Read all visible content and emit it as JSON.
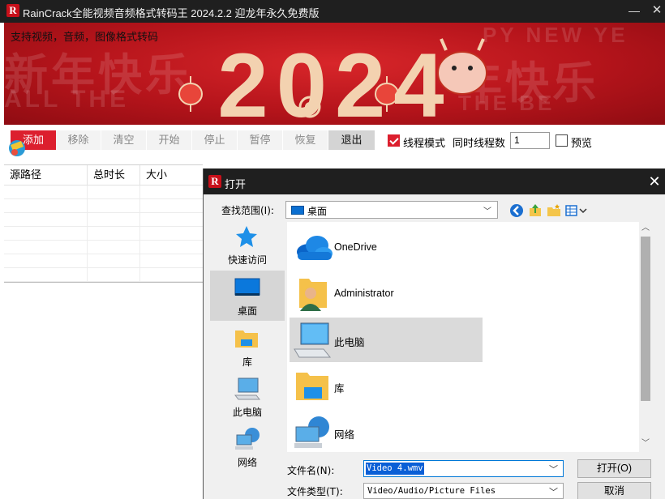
{
  "window": {
    "logo_letter": "R",
    "title": "RainCrack全能视频音频格式转码王 2024.2.2 迎龙年永久免费版",
    "minimize_glyph": "—",
    "close_glyph": "✕"
  },
  "banner": {
    "subtitle": "支持视频，音频，图像格式转码",
    "year": "2024",
    "bg_words": [
      "新年快乐",
      "ALL THE",
      "年快乐",
      "THE BE",
      "PY NEW YE"
    ],
    "colors": {
      "red": "#b5141b",
      "gold": "#f3d2b0"
    }
  },
  "toolbar": {
    "add": "添加",
    "remove": "移除",
    "clear": "清空",
    "start": "开始",
    "stop": "停止",
    "pause": "暂停",
    "resume": "恢复",
    "quit": "退出",
    "thread_mode_label": "线程模式",
    "thread_mode_checked": true,
    "concurrent_label": "同时线程数",
    "concurrent_value": "1",
    "preview_label": "预览",
    "preview_checked": false
  },
  "table": {
    "columns": [
      "源路径",
      "总时长",
      "大小"
    ],
    "rows": []
  },
  "dialog": {
    "logo_letter": "R",
    "title": "打开",
    "close_glyph": "✕",
    "look_in_label": "查找范围(I):",
    "look_in_value": "桌面",
    "places": [
      {
        "label": "快速访问",
        "icon": "star-icon"
      },
      {
        "label": "桌面",
        "icon": "desktop-icon",
        "selected": true
      },
      {
        "label": "库",
        "icon": "library-icon"
      },
      {
        "label": "此电脑",
        "icon": "computer-icon"
      },
      {
        "label": "网络",
        "icon": "network-icon"
      }
    ],
    "files": [
      {
        "name": "OneDrive",
        "icon": "cloud-icon"
      },
      {
        "name": "Administrator",
        "icon": "user-folder-icon"
      },
      {
        "name": "此电脑",
        "icon": "computer-icon",
        "selected": true
      },
      {
        "name": "库",
        "icon": "library-icon"
      },
      {
        "name": "网络",
        "icon": "network-icon"
      }
    ],
    "filename_label": "文件名(N):",
    "filename_value": "Video 4.wmv",
    "filetype_label": "文件类型(T):",
    "filetype_value": "Video/Audio/Picture Files",
    "open_button": "打开(O)",
    "cancel_button": "取消"
  }
}
